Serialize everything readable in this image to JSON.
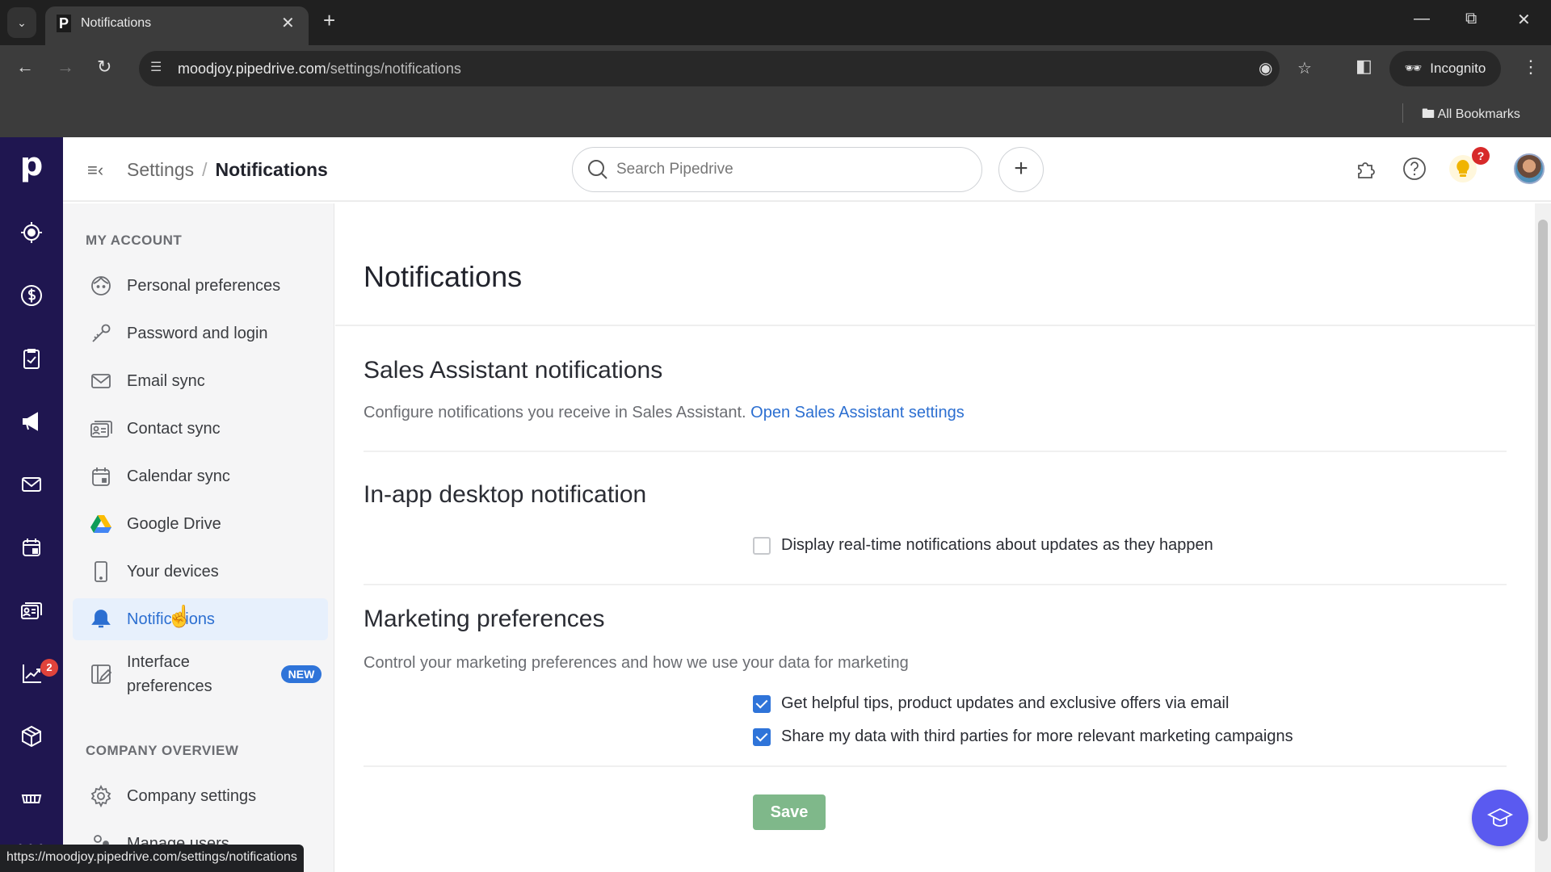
{
  "browser": {
    "tab_title": "Notifications",
    "tab_favicon": "P",
    "url_host": "moodjoy.pipedrive.com",
    "url_path": "/settings/notifications",
    "profile_label": "Incognito",
    "bookmarks_label": "All Bookmarks",
    "status_url": "https://moodjoy.pipedrive.com/settings/notifications"
  },
  "header": {
    "breadcrumb": [
      "Settings",
      "Notifications"
    ],
    "search_placeholder": "Search Pipedrive",
    "add_label": "+",
    "tips_badge": "?"
  },
  "rail": {
    "items": [
      "leads-icon",
      "deals-icon",
      "activities-icon",
      "campaigns-icon",
      "mail-icon",
      "calendar-icon",
      "contacts-icon",
      "insights-icon",
      "products-icon",
      "marketplace-icon",
      "more-icon"
    ],
    "calendar_badge": "2"
  },
  "settings_nav": {
    "sections": [
      {
        "title": "MY ACCOUNT",
        "items": [
          {
            "label": "Personal preferences",
            "icon": "face-icon"
          },
          {
            "label": "Password and login",
            "icon": "key-icon"
          },
          {
            "label": "Email sync",
            "icon": "envelope-icon"
          },
          {
            "label": "Contact sync",
            "icon": "contact-card-icon"
          },
          {
            "label": "Calendar sync",
            "icon": "calendar-icon"
          },
          {
            "label": "Google Drive",
            "icon": "google-drive-icon"
          },
          {
            "label": "Your devices",
            "icon": "phone-icon"
          },
          {
            "label": "Notifications",
            "icon": "bell-icon",
            "active": true
          },
          {
            "label": "Interface preferences",
            "icon": "interface-icon",
            "badge": "NEW"
          }
        ]
      },
      {
        "title": "COMPANY OVERVIEW",
        "items": [
          {
            "label": "Company settings",
            "icon": "gear-icon"
          },
          {
            "label": "Manage users",
            "icon": "users-icon"
          }
        ]
      }
    ]
  },
  "main": {
    "title": "Notifications",
    "sales_assistant": {
      "title": "Sales Assistant notifications",
      "desc": "Configure notifications you receive in Sales Assistant.",
      "link": "Open Sales Assistant settings"
    },
    "in_app": {
      "title": "In-app desktop notification",
      "options": [
        {
          "label": "Display real-time notifications about updates as they happen",
          "checked": false
        }
      ]
    },
    "marketing": {
      "title": "Marketing preferences",
      "desc": "Control your marketing preferences and how we use your data for marketing",
      "options": [
        {
          "label": "Get helpful tips, product updates and exclusive offers via email",
          "checked": true
        },
        {
          "label": "Share my data with third parties for more relevant marketing campaigns",
          "checked": true
        }
      ]
    },
    "save_label": "Save"
  },
  "colors": {
    "rail_bg": "#1f1650",
    "accent_blue": "#2f74d9",
    "save_green": "#7fb88a",
    "academy_purple": "#5a5af0"
  }
}
